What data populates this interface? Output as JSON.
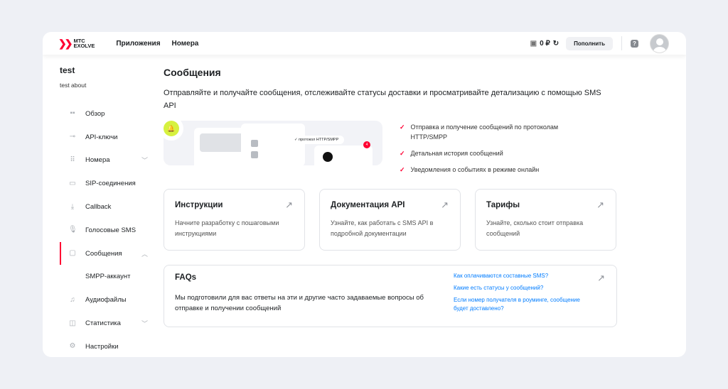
{
  "header": {
    "logo_line1": "МТС",
    "logo_line2": "EXOLVE",
    "nav": [
      "Приложения",
      "Номера"
    ],
    "balance": "0 ₽",
    "topup": "Пополнить"
  },
  "sidebar": {
    "project": "test",
    "project_about": "test about",
    "items": [
      {
        "label": "Обзор",
        "icon": "grid-icon"
      },
      {
        "label": "API-ключи",
        "icon": "key-icon"
      },
      {
        "label": "Номера",
        "icon": "dialpad-icon",
        "chevron": "down"
      },
      {
        "label": "SIP-соединения",
        "icon": "sip-icon"
      },
      {
        "label": "Callback",
        "icon": "callback-icon"
      },
      {
        "label": "Голосовые SMS",
        "icon": "microphone-icon"
      },
      {
        "label": "Сообщения",
        "icon": "chat-icon",
        "chevron": "up",
        "active": true
      },
      {
        "label": "SMPP-аккаунт",
        "sub": true
      },
      {
        "label": "Аудиофайлы",
        "icon": "music-icon"
      },
      {
        "label": "Статистика",
        "icon": "chart-icon",
        "chevron": "down"
      },
      {
        "label": "Настройки",
        "icon": "gear-icon"
      }
    ]
  },
  "main": {
    "title": "Сообщения",
    "lead": "Отправляйте и получайте сообщения, отслеживайте статусы доставки и просматривайте детализацию с помощью SMS API",
    "illustration": {
      "protocol_chip": "протокол HTTP/SMPP",
      "badge": "4"
    },
    "features": [
      "Отправка и получение сообщений по протоколам HTTP/SMPP",
      "Детальная история сообщений",
      "Уведомления о событиях в режиме онлайн"
    ],
    "cards": [
      {
        "title": "Инструкции",
        "text": "Начните разработку с пошаговыми инструкциями"
      },
      {
        "title": "Документация API",
        "text": "Узнайте, как работать с SMS API в подробной документации"
      },
      {
        "title": "Тарифы",
        "text": "Узнайте, сколько стоит отправка сообщений"
      }
    ],
    "faq": {
      "title": "FAQs",
      "text": "Мы подготовили для вас ответы на эти и другие часто задаваемые вопросы об отправке и получении сообщений",
      "links": [
        "Как оплачиваются составные SMS?",
        "Какие есть статусы у сообщений?",
        "Если номер получателя в роуминге, сообщение будет доставлено?"
      ]
    }
  },
  "colors": {
    "accent": "#ff0032",
    "link": "#007cff"
  }
}
